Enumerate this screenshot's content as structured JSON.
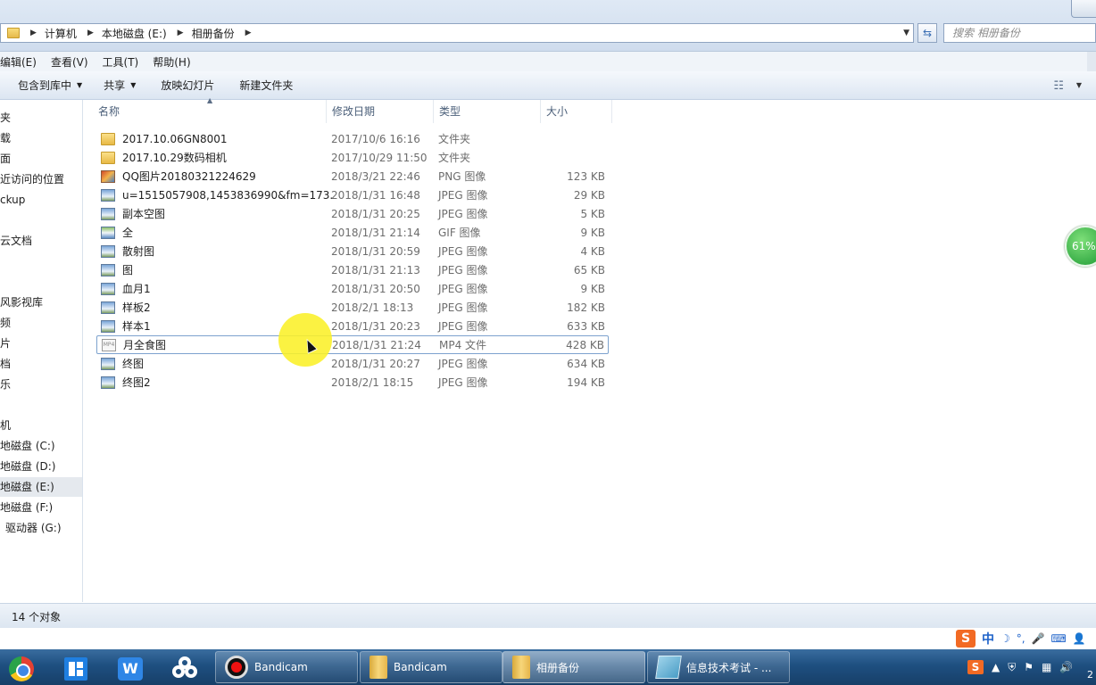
{
  "address": {
    "crumbs": [
      "计算机",
      "本地磁盘 (E:)",
      "相册备份"
    ],
    "search_placeholder": "搜索 相册备份"
  },
  "menu": [
    "编辑(E)",
    "查看(V)",
    "工具(T)",
    "帮助(H)"
  ],
  "toolbar": {
    "include_library": "包含到库中",
    "share": "共享",
    "slideshow": "放映幻灯片",
    "new_folder": "新建文件夹"
  },
  "nav": {
    "items": [
      "夹",
      "载",
      "面",
      "近访问的位置",
      "ckup",
      "云文档",
      "风影视库",
      "频",
      "片",
      "档",
      "乐",
      "机",
      "地磁盘 (C:)",
      "地磁盘 (D:)",
      "地磁盘 (E:)",
      "地磁盘 (F:)",
      "驱动器 (G:)"
    ]
  },
  "columns": {
    "name": "名称",
    "date": "修改日期",
    "type": "类型",
    "size": "大小"
  },
  "files": [
    {
      "name": "2017.10.06GN8001",
      "date": "2017/10/6 16:16",
      "type": "文件夹",
      "size": "",
      "icon": "folder-icon"
    },
    {
      "name": "2017.10.29数码相机",
      "date": "2017/10/29 11:50",
      "type": "文件夹",
      "size": "",
      "icon": "folder-icon"
    },
    {
      "name": "QQ图片20180321224629",
      "date": "2018/3/21 22:46",
      "type": "PNG 图像",
      "size": "123 KB",
      "icon": "png-image-icon"
    },
    {
      "name": "u=1515057908,1453836990&fm=173...",
      "date": "2018/1/31 16:48",
      "type": "JPEG 图像",
      "size": "29 KB",
      "icon": "jpeg-image-icon"
    },
    {
      "name": "副本空图",
      "date": "2018/1/31 20:25",
      "type": "JPEG 图像",
      "size": "5 KB",
      "icon": "jpeg-image-icon"
    },
    {
      "name": "全",
      "date": "2018/1/31 21:14",
      "type": "GIF 图像",
      "size": "9 KB",
      "icon": "gif-image-icon"
    },
    {
      "name": "散射图",
      "date": "2018/1/31 20:59",
      "type": "JPEG 图像",
      "size": "4 KB",
      "icon": "jpeg-image-icon"
    },
    {
      "name": "图",
      "date": "2018/1/31 21:13",
      "type": "JPEG 图像",
      "size": "65 KB",
      "icon": "jpeg-image-icon"
    },
    {
      "name": "血月1",
      "date": "2018/1/31 20:50",
      "type": "JPEG 图像",
      "size": "9 KB",
      "icon": "jpeg-image-icon"
    },
    {
      "name": "样板2",
      "date": "2018/2/1 18:13",
      "type": "JPEG 图像",
      "size": "182 KB",
      "icon": "jpeg-image-icon"
    },
    {
      "name": "样本1",
      "date": "2018/1/31 20:23",
      "type": "JPEG 图像",
      "size": "633 KB",
      "icon": "jpeg-image-icon"
    },
    {
      "name": "月全食图",
      "date": "2018/1/31 21:24",
      "type": "MP4 文件",
      "size": "428 KB",
      "icon": "mp4-file-icon"
    },
    {
      "name": "终图",
      "date": "2018/1/31 20:27",
      "type": "JPEG 图像",
      "size": "634 KB",
      "icon": "jpeg-image-icon"
    },
    {
      "name": "终图2",
      "date": "2018/2/1 18:15",
      "type": "JPEG 图像",
      "size": "194 KB",
      "icon": "jpeg-image-icon"
    }
  ],
  "mp4_icon_label": "MP4",
  "widget": {
    "percent": "61%"
  },
  "status": {
    "count": "14 个对象"
  },
  "ime": {
    "logo": "S",
    "mode": "中",
    "moon": "☽",
    "punct": "°,",
    "mic": "🎤"
  },
  "taskbar": {
    "wps_letter": "W",
    "buttons": [
      "Bandicam",
      "Bandicam",
      "相册备份",
      "信息技术考试 - ..."
    ],
    "tray_logo": "S",
    "clock_fragment": "2"
  },
  "colors": {
    "accent": "#3a6d9f",
    "selection_border": "#7da2ce",
    "widget_green": "#1d9a34",
    "cursor_highlight": "#faf028"
  }
}
